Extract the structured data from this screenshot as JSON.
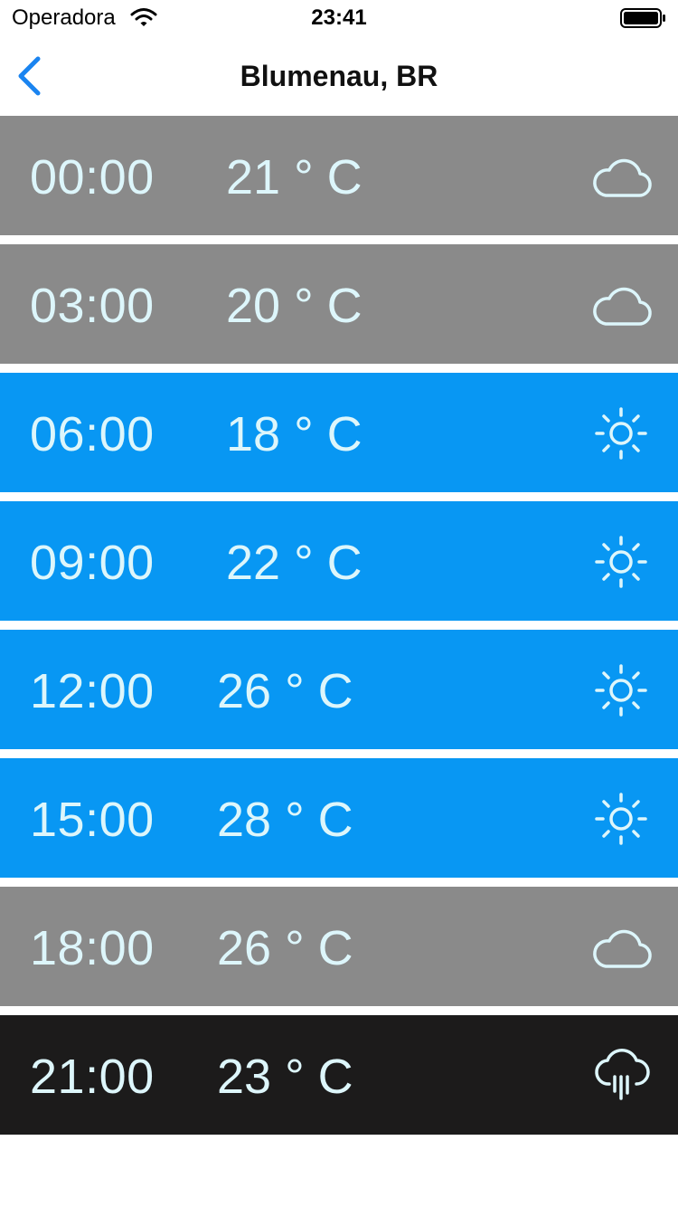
{
  "status_bar": {
    "carrier": "Operadora",
    "time": "23:41"
  },
  "nav": {
    "title": "Blumenau, BR",
    "accent_color": "#1a84f0"
  },
  "colors": {
    "cloudy_row": "#8a8a8a",
    "sunny_row": "#0897f3",
    "rain_row": "#1c1b1b",
    "row_text": "#ddf6fb"
  },
  "forecast": [
    {
      "time": "00:00",
      "temp": "21 ° C",
      "condition": "cloudy",
      "icon": "cloud-icon"
    },
    {
      "time": "03:00",
      "temp": "20 ° C",
      "condition": "cloudy",
      "icon": "cloud-icon"
    },
    {
      "time": "06:00",
      "temp": "18 ° C",
      "condition": "sunny",
      "icon": "sun-icon"
    },
    {
      "time": "09:00",
      "temp": "22 ° C",
      "condition": "sunny",
      "icon": "sun-icon"
    },
    {
      "time": "12:00",
      "temp": "26 ° C",
      "condition": "sunny",
      "icon": "sun-icon"
    },
    {
      "time": "15:00",
      "temp": "28 ° C",
      "condition": "sunny",
      "icon": "sun-icon"
    },
    {
      "time": "18:00",
      "temp": "26 ° C",
      "condition": "cloudy",
      "icon": "cloud-icon"
    },
    {
      "time": "21:00",
      "temp": "23 ° C",
      "condition": "rain",
      "icon": "rain-cloud-icon"
    }
  ]
}
